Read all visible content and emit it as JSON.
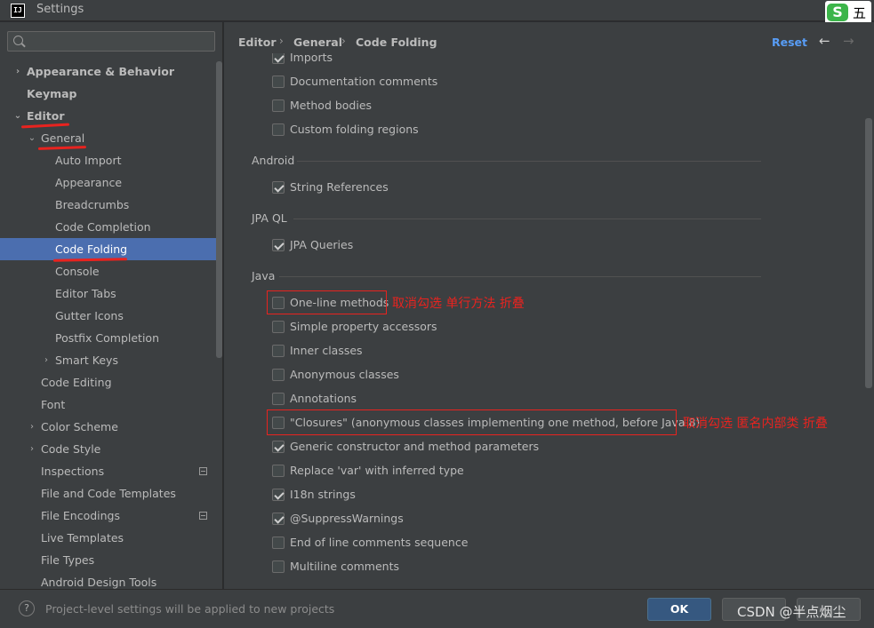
{
  "window": {
    "title": "Settings",
    "app_icon": "IJ",
    "ime_label": "五"
  },
  "sidebar": {
    "search_placeholder": "",
    "items": [
      {
        "label": "Appearance & Behavior",
        "bold": true,
        "arrow": "›"
      },
      {
        "label": "Keymap",
        "bold": true,
        "arrow": ""
      },
      {
        "label": "Editor",
        "bold": true,
        "arrow": "⌄"
      },
      {
        "label": "General",
        "bold": false,
        "arrow": "⌄"
      },
      {
        "label": "Auto Import"
      },
      {
        "label": "Appearance"
      },
      {
        "label": "Breadcrumbs"
      },
      {
        "label": "Code Completion"
      },
      {
        "label": "Code Folding"
      },
      {
        "label": "Console"
      },
      {
        "label": "Editor Tabs"
      },
      {
        "label": "Gutter Icons"
      },
      {
        "label": "Postfix Completion"
      },
      {
        "label": "Smart Keys",
        "arrow": "›"
      },
      {
        "label": "Code Editing"
      },
      {
        "label": "Font"
      },
      {
        "label": "Color Scheme",
        "arrow": "›"
      },
      {
        "label": "Code Style",
        "arrow": "›"
      },
      {
        "label": "Inspections"
      },
      {
        "label": "File and Code Templates"
      },
      {
        "label": "File Encodings"
      },
      {
        "label": "Live Templates"
      },
      {
        "label": "File Types"
      },
      {
        "label": "Android Design Tools"
      }
    ]
  },
  "breadcrumb": [
    "Editor",
    "General",
    "Code Folding"
  ],
  "toolbar": {
    "reset_label": "Reset",
    "back_icon": "←",
    "forward_icon": "→"
  },
  "folding": {
    "top_items": [
      {
        "label": "Imports",
        "checked": true
      },
      {
        "label": "Documentation comments",
        "checked": false
      },
      {
        "label": "Method bodies",
        "checked": false
      },
      {
        "label": "Custom folding regions",
        "checked": false
      }
    ],
    "sections": [
      {
        "title": "Android",
        "items": [
          {
            "label": "String References",
            "checked": true
          }
        ]
      },
      {
        "title": "JPA QL",
        "items": [
          {
            "label": "JPA Queries",
            "checked": true
          }
        ]
      },
      {
        "title": "Java",
        "items": [
          {
            "label": "One-line methods",
            "checked": false
          },
          {
            "label": "Simple property accessors",
            "checked": false
          },
          {
            "label": "Inner classes",
            "checked": false
          },
          {
            "label": "Anonymous classes",
            "checked": false
          },
          {
            "label": "Annotations",
            "checked": false
          },
          {
            "label": "\"Closures\" (anonymous classes implementing one method, before Java 8)",
            "checked": false
          },
          {
            "label": "Generic constructor and method parameters",
            "checked": true
          },
          {
            "label": "Replace 'var' with inferred type",
            "checked": false
          },
          {
            "label": "I18n strings",
            "checked": true
          },
          {
            "label": "@SuppressWarnings",
            "checked": true
          },
          {
            "label": "End of line comments sequence",
            "checked": false
          },
          {
            "label": "Multiline comments",
            "checked": false
          }
        ]
      }
    ]
  },
  "annotations": {
    "one_line": "取消勾选 单行方法 折叠",
    "closures": "取消勾选 匿名内部类 折叠"
  },
  "footer": {
    "help_icon": "?",
    "hint": "Project-level settings will be applied to new projects",
    "ok_label": "OK",
    "watermark": "CSDN @半点烟尘"
  },
  "colors": {
    "accent": "#4b6eaf",
    "link": "#589df6",
    "annotation": "#e8231f"
  }
}
